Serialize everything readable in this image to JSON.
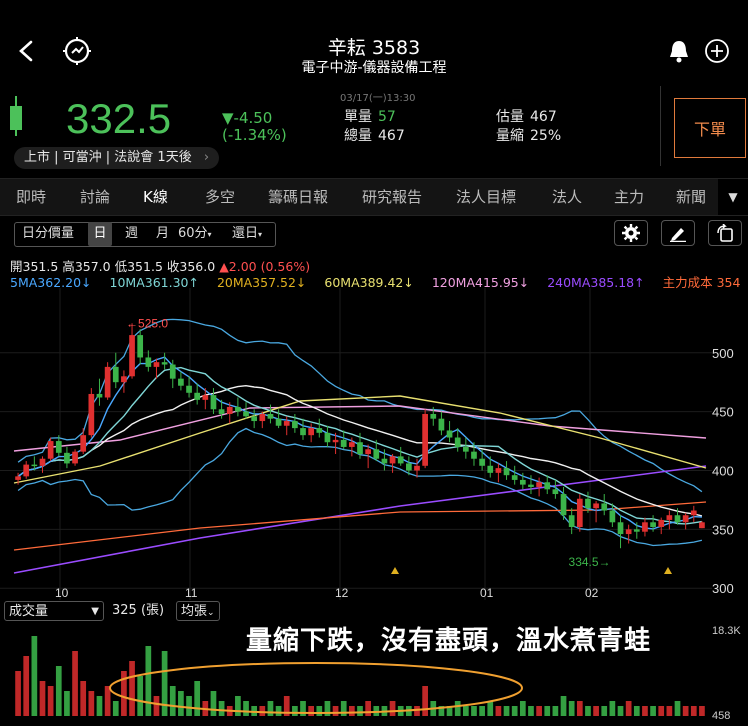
{
  "header": {
    "title": "辛耘 3583",
    "subtitle": "電子中游-儀器設備工程"
  },
  "quote": {
    "price": "332.5",
    "change": "▼-4.50",
    "change_pct": "(-1.34%)",
    "timestamp": "03/17(一)13:30",
    "unit_vol_label": "單量",
    "unit_vol_value": "57",
    "total_vol_label": "總量",
    "total_vol_value": "467",
    "est_vol_label": "估量",
    "est_vol_value": "467",
    "vol_shrink_label": "量縮",
    "vol_shrink_value": "25%",
    "tags": "上市 | 可當沖 | 法說會 1天後",
    "order_button": "下單"
  },
  "tabs": [
    "即時",
    "討論",
    "K線",
    "多空",
    "籌碼日報",
    "研究報告",
    "法人目標",
    "法人",
    "主力",
    "新聞"
  ],
  "active_tab": "K線",
  "toolbar": {
    "mode": "日分價量",
    "periods": [
      "日",
      "週",
      "月"
    ],
    "interval": "60分",
    "adjust": "還日"
  },
  "ohlc": {
    "open_label": "開",
    "open": "351.5",
    "high_label": "高",
    "high": "357.0",
    "low_label": "低",
    "low": "351.5",
    "close_label": "收",
    "close": "356.0",
    "change": "▲2.00 (0.56%)"
  },
  "ma": [
    {
      "text": "5MA362.20↓",
      "color": "#4aa8ff"
    },
    {
      "text": "10MA361.30↑",
      "color": "#7fd6d6"
    },
    {
      "text": "20MA357.52↓",
      "color": "#e0b020"
    },
    {
      "text": "60MA389.42↓",
      "color": "#e8e070"
    },
    {
      "text": "120MA415.95↓",
      "color": "#f0a0e0"
    },
    {
      "text": "240MA385.18↑",
      "color": "#9a4cff"
    },
    {
      "text": "主力成本 354",
      "color": "#ff6a3a"
    }
  ],
  "chart_data": {
    "type": "candlestick",
    "y_ticks": [
      "500",
      "450",
      "400",
      "350",
      "300"
    ],
    "ylim": [
      290,
      555
    ],
    "x_ticks": [
      "10",
      "11",
      "12",
      "01",
      "02"
    ],
    "annotations": {
      "high": "←525.0",
      "low": "334.5→"
    },
    "candles": [
      [
        392,
        398,
        388,
        395
      ],
      [
        395,
        408,
        393,
        405
      ],
      [
        405,
        412,
        400,
        404
      ],
      [
        404,
        412,
        398,
        410
      ],
      [
        410,
        428,
        408,
        425
      ],
      [
        425,
        430,
        412,
        415
      ],
      [
        415,
        420,
        402,
        406
      ],
      [
        406,
        418,
        404,
        416
      ],
      [
        416,
        436,
        414,
        430
      ],
      [
        430,
        470,
        428,
        465
      ],
      [
        465,
        478,
        455,
        462
      ],
      [
        462,
        492,
        460,
        488
      ],
      [
        488,
        500,
        470,
        475
      ],
      [
        475,
        485,
        466,
        480
      ],
      [
        480,
        525,
        478,
        515
      ],
      [
        515,
        520,
        490,
        496
      ],
      [
        496,
        502,
        484,
        488
      ],
      [
        488,
        495,
        478,
        492
      ],
      [
        492,
        500,
        486,
        490
      ],
      [
        490,
        494,
        470,
        478
      ],
      [
        478,
        484,
        468,
        472
      ],
      [
        472,
        480,
        462,
        466
      ],
      [
        466,
        474,
        456,
        460
      ],
      [
        460,
        470,
        452,
        464
      ],
      [
        464,
        470,
        448,
        452
      ],
      [
        452,
        460,
        444,
        448
      ],
      [
        448,
        458,
        440,
        454
      ],
      [
        454,
        462,
        446,
        450
      ],
      [
        450,
        458,
        444,
        446
      ],
      [
        446,
        452,
        436,
        442
      ],
      [
        442,
        450,
        436,
        448
      ],
      [
        448,
        456,
        440,
        444
      ],
      [
        444,
        452,
        436,
        438
      ],
      [
        438,
        446,
        430,
        442
      ],
      [
        442,
        448,
        432,
        436
      ],
      [
        436,
        444,
        426,
        430
      ],
      [
        430,
        440,
        424,
        436
      ],
      [
        436,
        444,
        428,
        432
      ],
      [
        432,
        438,
        420,
        424
      ],
      [
        424,
        432,
        414,
        426
      ],
      [
        426,
        434,
        418,
        420
      ],
      [
        420,
        428,
        412,
        424
      ],
      [
        424,
        432,
        410,
        414
      ],
      [
        414,
        422,
        402,
        418
      ],
      [
        418,
        426,
        408,
        410
      ],
      [
        410,
        418,
        400,
        406
      ],
      [
        406,
        414,
        398,
        412
      ],
      [
        412,
        420,
        404,
        406
      ],
      [
        406,
        412,
        396,
        400
      ],
      [
        400,
        410,
        394,
        404
      ],
      [
        404,
        452,
        402,
        448
      ],
      [
        448,
        454,
        438,
        444
      ],
      [
        444,
        450,
        430,
        434
      ],
      [
        434,
        442,
        424,
        428
      ],
      [
        428,
        436,
        416,
        420
      ],
      [
        420,
        428,
        410,
        416
      ],
      [
        416,
        424,
        404,
        410
      ],
      [
        410,
        418,
        400,
        404
      ],
      [
        404,
        412,
        394,
        398
      ],
      [
        398,
        406,
        390,
        402
      ],
      [
        402,
        408,
        392,
        396
      ],
      [
        396,
        404,
        388,
        392
      ],
      [
        392,
        398,
        384,
        388
      ],
      [
        388,
        396,
        380,
        386
      ],
      [
        386,
        394,
        378,
        390
      ],
      [
        390,
        396,
        380,
        384
      ],
      [
        384,
        392,
        376,
        380
      ],
      [
        380,
        386,
        358,
        362
      ],
      [
        362,
        368,
        346,
        352
      ],
      [
        352,
        380,
        348,
        376
      ],
      [
        376,
        382,
        364,
        368
      ],
      [
        368,
        374,
        356,
        372
      ],
      [
        372,
        380,
        362,
        366
      ],
      [
        366,
        372,
        352,
        356
      ],
      [
        356,
        362,
        334,
        346
      ],
      [
        346,
        354,
        338,
        350
      ],
      [
        350,
        356,
        342,
        348
      ],
      [
        348,
        360,
        344,
        356
      ],
      [
        356,
        362,
        348,
        352
      ],
      [
        352,
        360,
        346,
        358
      ],
      [
        358,
        366,
        350,
        362
      ],
      [
        362,
        368,
        354,
        356
      ],
      [
        356,
        364,
        350,
        362
      ],
      [
        362,
        370,
        356,
        366
      ],
      [
        351,
        357,
        351,
        356
      ]
    ],
    "volume": {
      "label": "成交量",
      "value": "325 (張)",
      "mode": "均張",
      "ymax_label": "18.3K",
      "ymin_label": "458",
      "bars": [
        9,
        12,
        16,
        7,
        6,
        10,
        5,
        13,
        7,
        5,
        4,
        6,
        3,
        9,
        11,
        8,
        14,
        4,
        13,
        6,
        5,
        4,
        7,
        3,
        5,
        3,
        2,
        4,
        3,
        2,
        2,
        3,
        2,
        4,
        2,
        3,
        2,
        2,
        3,
        2,
        3,
        2,
        2,
        3,
        2,
        2,
        3,
        2,
        2,
        2,
        6,
        3,
        2,
        2,
        3,
        2,
        2,
        2,
        3,
        2,
        2,
        2,
        3,
        2,
        2,
        2,
        2,
        4,
        3,
        3,
        2,
        2,
        2,
        3,
        2,
        3,
        2,
        2,
        2,
        2,
        2,
        3,
        2,
        2,
        2
      ]
    },
    "annotation_text": "量縮下跌，沒有盡頭，溫水煮青蛙"
  }
}
